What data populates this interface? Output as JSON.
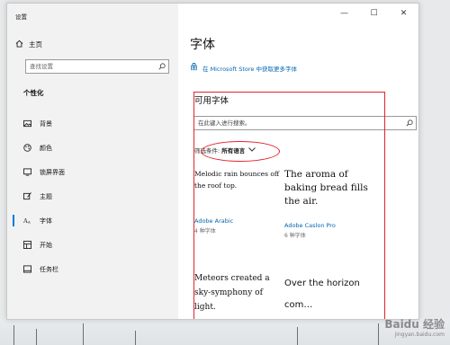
{
  "window": {
    "title": "设置"
  },
  "sidebar": {
    "home": "主页",
    "search_placeholder": "查找设置",
    "section": "个性化",
    "items": [
      {
        "label": "背景",
        "icon": "image-icon"
      },
      {
        "label": "颜色",
        "icon": "palette-icon"
      },
      {
        "label": "锁屏界面",
        "icon": "lock-screen-icon"
      },
      {
        "label": "主题",
        "icon": "brush-icon"
      },
      {
        "label": "字体",
        "icon": "font-icon",
        "active": true
      },
      {
        "label": "开始",
        "icon": "start-icon"
      },
      {
        "label": "任务栏",
        "icon": "taskbar-icon"
      }
    ]
  },
  "content": {
    "title": "字体",
    "store_link": "在 Microsoft Store 中获取更多字体",
    "available_title": "可用字体",
    "search_placeholder": "在此键入进行搜索。",
    "filter_label": "筛选条件:",
    "filter_value": "所有语言"
  },
  "fonts": [
    {
      "sample": "Melodic rain bounces off the roof top.",
      "name": "Adobe Arabic",
      "count": "4 种字体"
    },
    {
      "sample": "The aroma of baking bread fills the air.",
      "name": "Adobe Caslon Pro",
      "count": "6 种字体"
    },
    {
      "sample": "Meteors created a sky-symphony of light.",
      "name": "",
      "count": ""
    },
    {
      "sample": "Over the horizon com…",
      "name": "",
      "count": ""
    }
  ],
  "watermark": {
    "main": "Baidu 经验",
    "sub": "jingyan.baidu.com"
  },
  "colors": {
    "accent": "#0078d7",
    "link": "#0066b4",
    "annotation": "#e3242b"
  }
}
